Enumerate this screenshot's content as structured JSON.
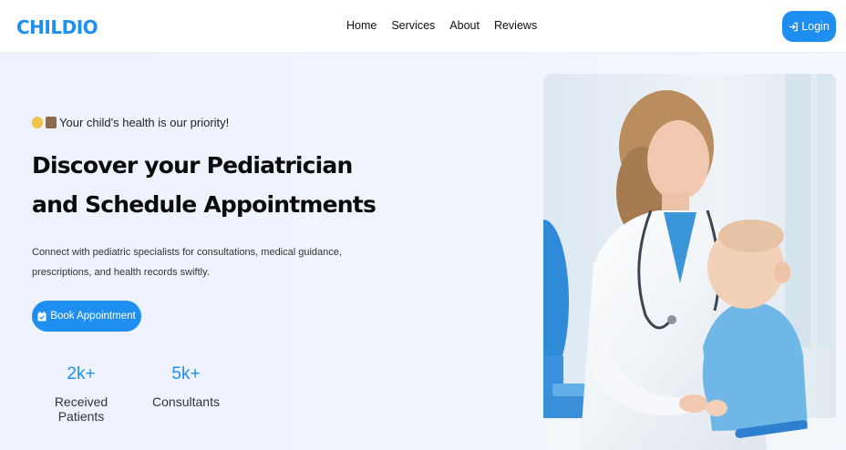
{
  "brand": {
    "logo": "CHILDIO",
    "accent_color": "#1e8ff0"
  },
  "nav": {
    "links": [
      {
        "label": "Home"
      },
      {
        "label": "Services"
      },
      {
        "label": "About"
      },
      {
        "label": "Reviews"
      }
    ],
    "login_label": "Login",
    "login_icon": "login-arrow-icon"
  },
  "hero": {
    "tagline": "Your child's health is our priority!",
    "tagline_icons": [
      "baby-face-icon",
      "hospital-icon"
    ],
    "headline_line1": "Discover your Pediatrician",
    "headline_line2": "and Schedule Appointments",
    "description": "Connect with pediatric specialists for consultations, medical guidance, prescriptions, and health records swiftly.",
    "book_button_label": "Book Appointment",
    "book_button_icon": "calendar-check-icon",
    "stats": [
      {
        "value": "2k+",
        "label": "Received Patients"
      },
      {
        "value": "5k+",
        "label": "Consultants"
      }
    ],
    "image_subject": "doctor-with-baby-photo"
  }
}
